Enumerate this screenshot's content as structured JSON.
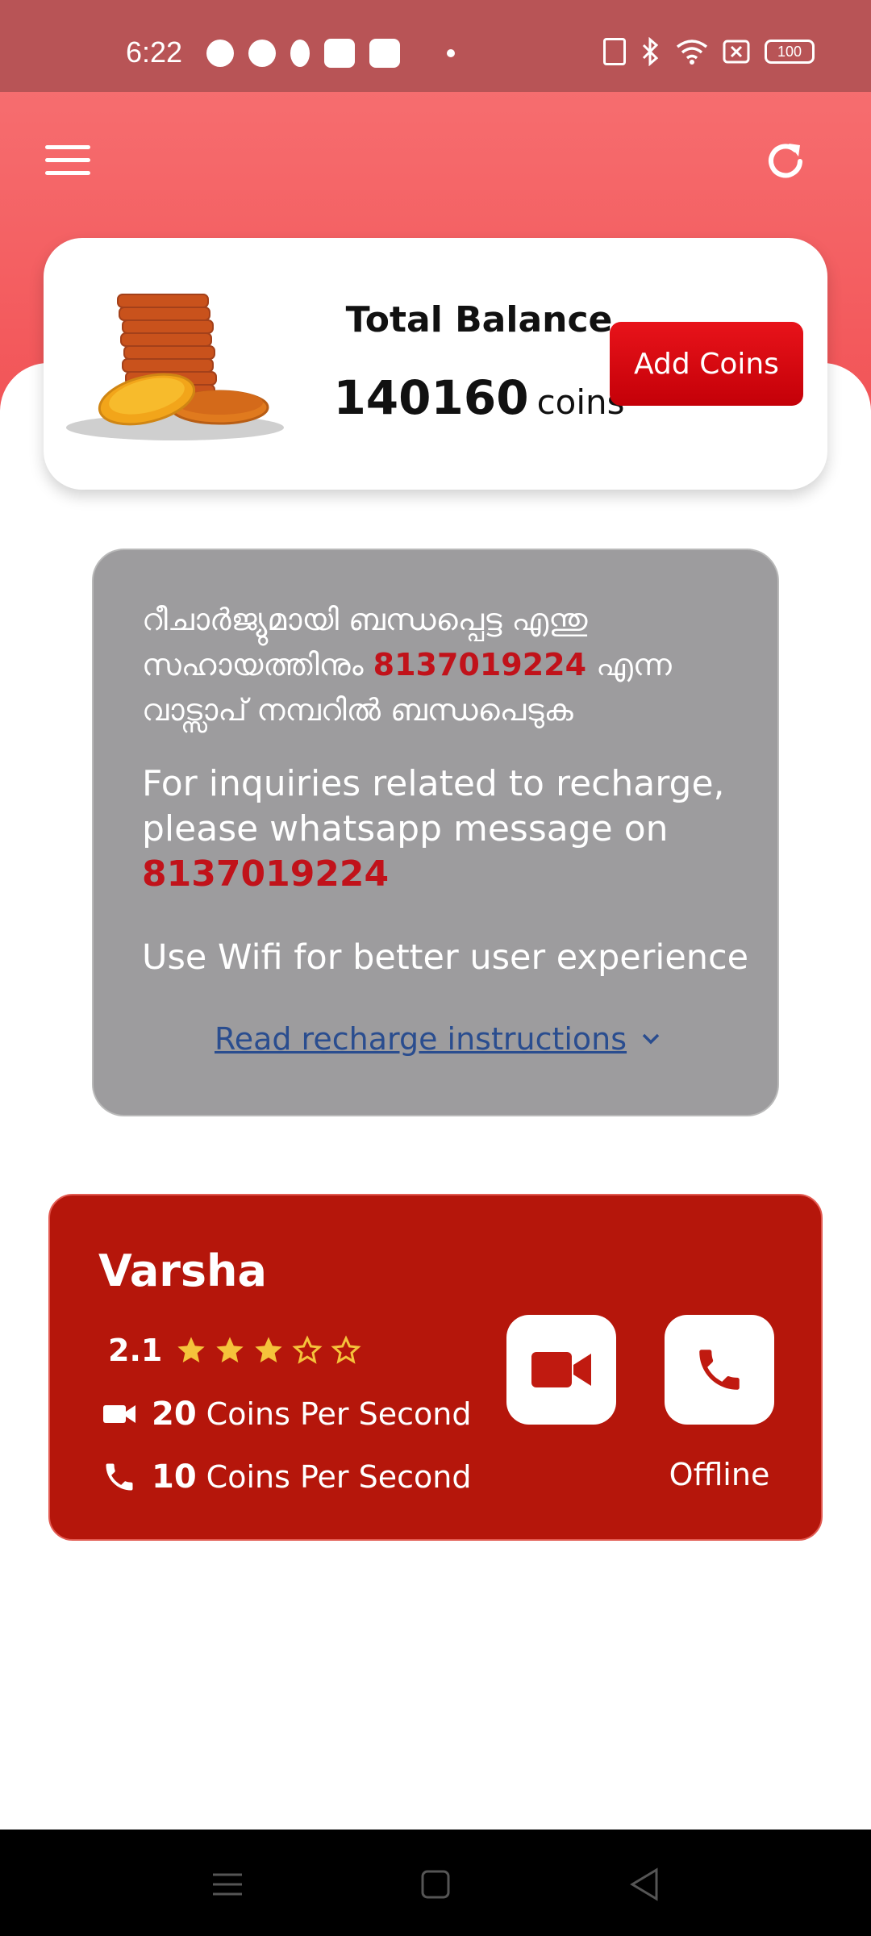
{
  "status_bar": {
    "time": "6:22",
    "battery": "100",
    "icons": [
      "notification-icon",
      "play-icon",
      "location-icon",
      "media-icon",
      "app-icon",
      "vibrate-icon",
      "bluetooth-icon",
      "wifi-icon",
      "sim-icon",
      "battery-icon"
    ]
  },
  "header": {
    "menu_icon": "menu-icon",
    "refresh_icon": "refresh-icon",
    "background_color": "#f25457"
  },
  "balance": {
    "title": "Total Balance",
    "amount": "140160",
    "unit": "coins",
    "add_button": "Add Coins"
  },
  "info": {
    "ml_line_before": "റീചാർജ്യുമായി ബന്ധപ്പെട്ട എന്തു സഹായത്തിനും ",
    "ml_phone": "8137019224",
    "ml_line_after": " എന്ന വാട്സാപ് നമ്പറിൽ ബന്ധപെടുക",
    "en_line": "For inquiries related to recharge, please whatsapp message on ",
    "en_phone": "8137019224",
    "wifi_note": "Use Wifi for better user experience",
    "instructions_link": "Read recharge instructions"
  },
  "agent": {
    "name": "Varsha",
    "rating": "2.1",
    "rating_value": 2.1,
    "stars_total": 5,
    "video_rate": "20",
    "call_rate": "10",
    "rate_suffix": "Coins Per Second",
    "status": "Offline",
    "card_color": "#b5160b"
  },
  "nav": {
    "items": [
      "recents-icon",
      "home-icon",
      "back-icon"
    ]
  }
}
